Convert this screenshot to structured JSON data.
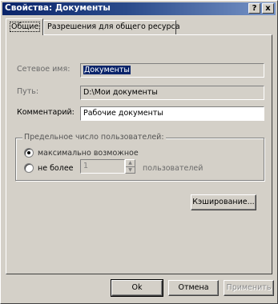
{
  "window": {
    "title": "Свойства: Документы"
  },
  "title_buttons": {
    "help": "?",
    "close": "x"
  },
  "tabs": [
    {
      "label": "Общие",
      "active": true
    },
    {
      "label": "Разрешения для общего ресурса",
      "active": false
    }
  ],
  "general": {
    "share_name_label": "Сетевое имя:",
    "share_name_value": "Документы",
    "path_label": "Путь:",
    "path_value": "D:\\Мои документы",
    "comment_label": "Комментарий:",
    "comment_value": "Рабочие документы",
    "user_limit": {
      "group_label": "Предельное число пользователей:",
      "max_allowed_label": "максимально возможное",
      "max_allowed_selected": true,
      "no_more_than_label": "не более",
      "no_more_than_value": "1",
      "users_suffix": "пользователей"
    },
    "caching_button": "Кэширование..."
  },
  "buttons": {
    "ok": "Ok",
    "cancel": "Отмена",
    "apply": "Применить"
  },
  "colors": {
    "title_gradient_start": "#0a246a",
    "title_gradient_end": "#7895c8",
    "face": "#d4d0c8",
    "selection": "#0a246a"
  }
}
